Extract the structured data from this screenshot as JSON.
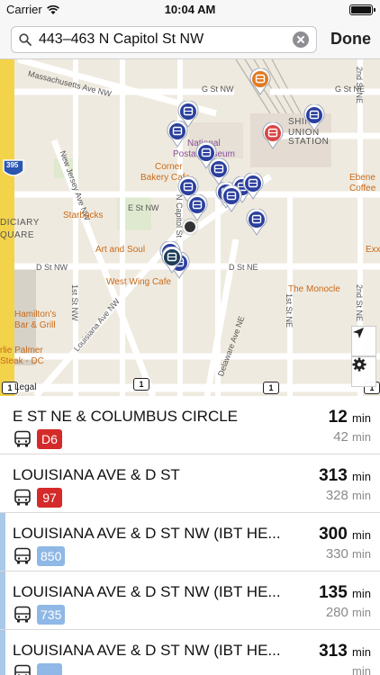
{
  "status_bar": {
    "carrier": "Carrier",
    "time": "10:04 AM"
  },
  "search": {
    "value": "443–463 N Capitol St NW",
    "done_label": "Done"
  },
  "map": {
    "labels": {
      "massachusetts": "Massachusetts Ave NW",
      "new_jersey": "New Jersey Ave NW",
      "g_st_nw": "G St NW",
      "g_st_ne": "G St NE",
      "e_st_nw": "E St NW",
      "d_st_nw": "D St NW",
      "d_st_ne": "D St NE",
      "louisiana": "Louisiana Ave NW",
      "delaware": "Delaware Ave NE",
      "second_st": "2nd St NE",
      "second_st_b": "2nd St NE",
      "first_st_nw": "1st St NW",
      "first_st_nw_b": "1st St NW",
      "first_st_ne": "1st St NE",
      "first_st_ne_b": "1st St NE",
      "n_capitol": "N Capitol St",
      "starbucks": "Starbucks",
      "art_soul": "Art and Soul",
      "west_wing": "West Wing Cafe",
      "monocle": "The Monocle",
      "corner_bakery_1": "Corner",
      "corner_bakery_2": "Bakery Cafe",
      "hamiltons_1": "Hamilton's",
      "hamiltons_2": "Bar & Grill",
      "charlie_1": "rlie Palmer",
      "charlie_2": "Steak - DC",
      "postal_1": "National",
      "postal_2": "Postal Museum",
      "union_1": "UNION",
      "union_2": "SHING",
      "union_3": "STATION",
      "judiciary_1": "DICIARY",
      "judiciary_2": "QUARE",
      "ebene_1": "Ebene",
      "ebene_2": "Coffee",
      "exx": "Exx",
      "interstate": "395",
      "us1_a": "1",
      "us1_b": "1",
      "us1_c": "1",
      "us1_d": "1",
      "legal": "Legal"
    }
  },
  "stops": [
    {
      "name": "E ST NE & COLUMBUS CIRCLE",
      "route": "D6",
      "route_color": "#d42a2a",
      "time1": "12",
      "time2": "42",
      "unit": "min",
      "highlight": false
    },
    {
      "name": "LOUISIANA AVE & D ST",
      "route": "97",
      "route_color": "#d42a2a",
      "time1": "313",
      "time2": "328",
      "unit": "min",
      "highlight": false
    },
    {
      "name": "LOUISIANA AVE & D ST NW (IBT HE...",
      "route": "850",
      "route_color": "#8fb8e6",
      "time1": "300",
      "time2": "330",
      "unit": "min",
      "highlight": true
    },
    {
      "name": "LOUISIANA AVE & D ST NW (IBT HE...",
      "route": "735",
      "route_color": "#8fb8e6",
      "time1": "135",
      "time2": "280",
      "unit": "min",
      "highlight": true
    },
    {
      "name": "LOUISIANA AVE & D ST NW (IBT HE...",
      "route": "",
      "route_color": "#8fb8e6",
      "time1": "313",
      "time2": "",
      "unit": "min",
      "highlight": true
    }
  ]
}
